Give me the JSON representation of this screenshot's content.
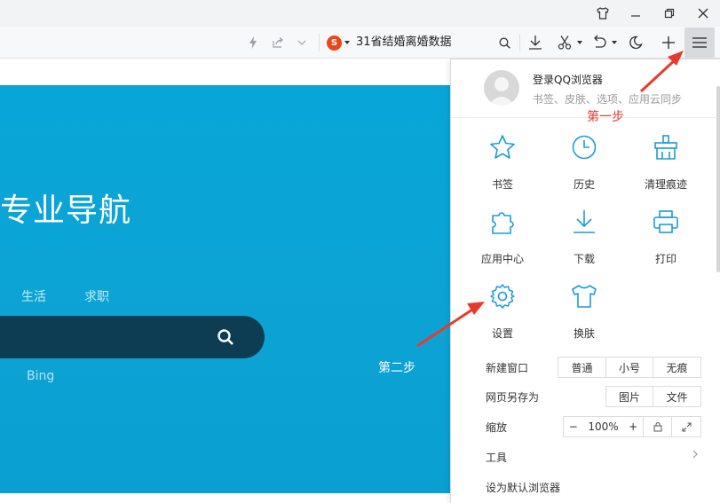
{
  "toolbar": {
    "search_text": "31省结婚离婚数据",
    "search_logo": "S"
  },
  "page": {
    "banner_title": "专业导航",
    "categories": [
      "生活",
      "求职"
    ],
    "engine": "Bing"
  },
  "annotations": {
    "step1": "第一步",
    "step2": "第二步"
  },
  "menu": {
    "account_name": "登录QQ浏览器",
    "account_sub": "书签、皮肤、选项、应用云同步",
    "grid": [
      {
        "label": "书签",
        "icon": "star-icon"
      },
      {
        "label": "历史",
        "icon": "clock-icon"
      },
      {
        "label": "清理痕迹",
        "icon": "broom-icon"
      },
      {
        "label": "应用中心",
        "icon": "puzzle-icon"
      },
      {
        "label": "下载",
        "icon": "download-icon"
      },
      {
        "label": "打印",
        "icon": "printer-icon"
      },
      {
        "label": "设置",
        "icon": "gear-icon"
      },
      {
        "label": "换肤",
        "icon": "tshirt-icon"
      }
    ],
    "new_window_label": "新建窗口",
    "new_window_options": [
      "普通",
      "小号",
      "无痕"
    ],
    "save_as_label": "网页另存为",
    "save_as_options": [
      "图片",
      "文件"
    ],
    "zoom_label": "缩放",
    "zoom_minus": "−",
    "zoom_value": "100%",
    "zoom_plus": "+",
    "tools_label": "工具",
    "default_browser_label": "设为默认浏览器"
  },
  "colors": {
    "accent": "#1a9bd7",
    "banner": "#08a6d8",
    "annotation_red": "#e83a2c"
  }
}
